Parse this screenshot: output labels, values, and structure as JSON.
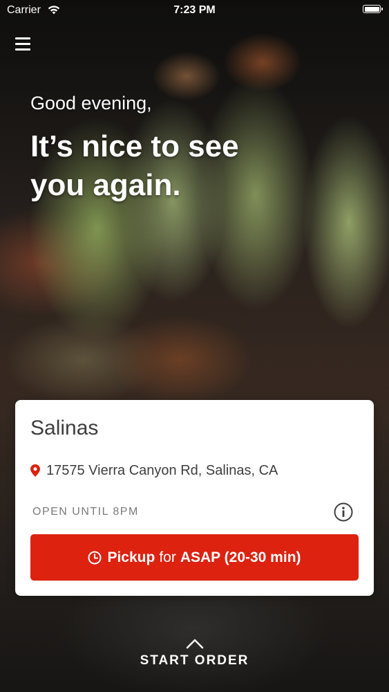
{
  "status_bar": {
    "carrier": "Carrier",
    "time": "7:23 PM"
  },
  "hero": {
    "greeting": "Good evening,",
    "welcome": "It’s nice to see you again."
  },
  "store": {
    "name": "Salinas",
    "address": "17575 Vierra Canyon Rd, Salinas, CA",
    "hours": "OPEN UNTIL 8PM"
  },
  "pickup_button": {
    "mode": "Pickup",
    "connector": "for",
    "time": "ASAP (20-30 min)"
  },
  "footer": {
    "start_order": "START ORDER"
  },
  "colors": {
    "accent": "#dd2210",
    "card": "#ffffff",
    "text_dark": "#3e3e3e",
    "muted": "#7a7a7a"
  },
  "icons": [
    "wifi-icon",
    "battery-icon",
    "menu-icon",
    "location-pin-icon",
    "info-icon",
    "clock-icon",
    "chevron-up-icon"
  ]
}
